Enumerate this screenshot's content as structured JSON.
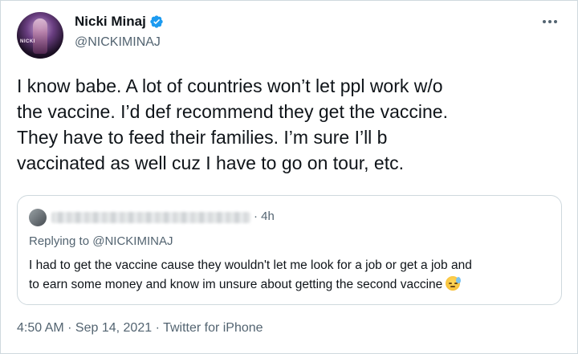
{
  "author": {
    "name": "Nicki Minaj",
    "handle": "@NICKIMINAJ",
    "avatar_text": "NICKI",
    "verified_color": "#1d9bf0"
  },
  "tweet": {
    "text": "I know babe. A lot of countries won’t let ppl work w/o\nthe vaccine. I’d def recommend they get the vaccine.\nThey have to feed their families. I’m sure I’ll b\nvaccinated as well cuz I have to go on tour, etc."
  },
  "quoted": {
    "time": "· 4h",
    "replying_prefix": "Replying to ",
    "replying_handle": "@NICKIMINAJ",
    "text": "I had to get the vaccine cause they wouldn't let me look for a job or get a job and\nto earn some money and know im unsure about getting the second vaccine",
    "emoji": "downcast-face-with-sweat-icon"
  },
  "meta": {
    "time": "4:50 AM",
    "sep1": " · ",
    "date": "Sep 14, 2021",
    "sep2": " · ",
    "source": "Twitter for iPhone"
  }
}
